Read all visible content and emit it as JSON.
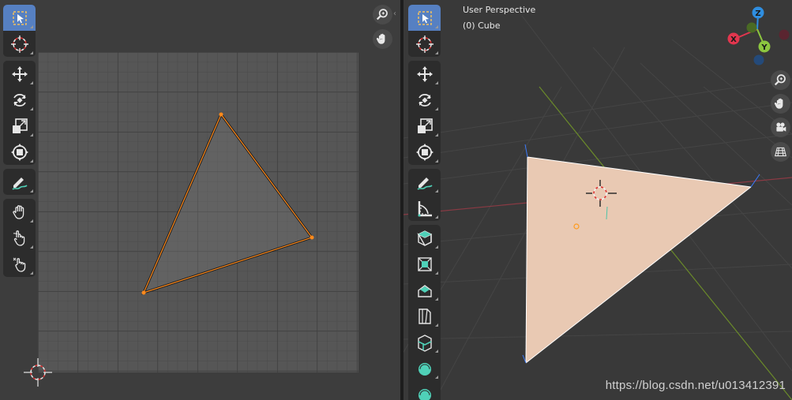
{
  "uv_editor": {
    "tools": [
      [
        {
          "icon": "select-box-icon",
          "active": true
        },
        {
          "icon": "cursor-icon"
        }
      ],
      [
        {
          "icon": "move-icon"
        },
        {
          "icon": "rotate-icon"
        },
        {
          "icon": "scale-icon"
        },
        {
          "icon": "transform-icon"
        }
      ],
      [
        {
          "icon": "annotate-icon"
        }
      ],
      [
        {
          "icon": "grab-icon"
        },
        {
          "icon": "relax-icon"
        },
        {
          "icon": "pinch-icon"
        }
      ]
    ],
    "nav_buttons": [
      "zoom-icon",
      "pan-hand-icon"
    ]
  },
  "viewport": {
    "view_name": "User Perspective",
    "object_label": "(0) Cube",
    "tools": [
      [
        {
          "icon": "select-box-icon",
          "active": true
        },
        {
          "icon": "cursor-icon"
        }
      ],
      [
        {
          "icon": "move-icon"
        },
        {
          "icon": "rotate-icon"
        },
        {
          "icon": "scale-icon"
        },
        {
          "icon": "transform-icon"
        }
      ],
      [
        {
          "icon": "annotate-icon"
        },
        {
          "icon": "measure-icon"
        }
      ],
      [
        {
          "icon": "add-cube-icon"
        },
        {
          "icon": "extrude-icon"
        },
        {
          "icon": "inset-icon"
        },
        {
          "icon": "bevel-icon"
        },
        {
          "icon": "loop-cut-icon"
        },
        {
          "icon": "knife-icon"
        },
        {
          "icon": "smooth-icon"
        }
      ]
    ],
    "nav_buttons": [
      "zoom-icon",
      "pan-hand-icon",
      "camera-icon",
      "grid-icon"
    ],
    "gizmo": {
      "x_label": "X",
      "y_label": "Y",
      "z_label": "Z",
      "x_color": "#e2364e",
      "y_color": "#8cc63f",
      "z_color": "#2f8ee0"
    }
  },
  "watermark": "https://blog.csdn.net/u013412391",
  "colors": {
    "accent": "#5680c2",
    "edge_highlight": "#ff8a1c",
    "face_fill": "#e9c9b3"
  }
}
